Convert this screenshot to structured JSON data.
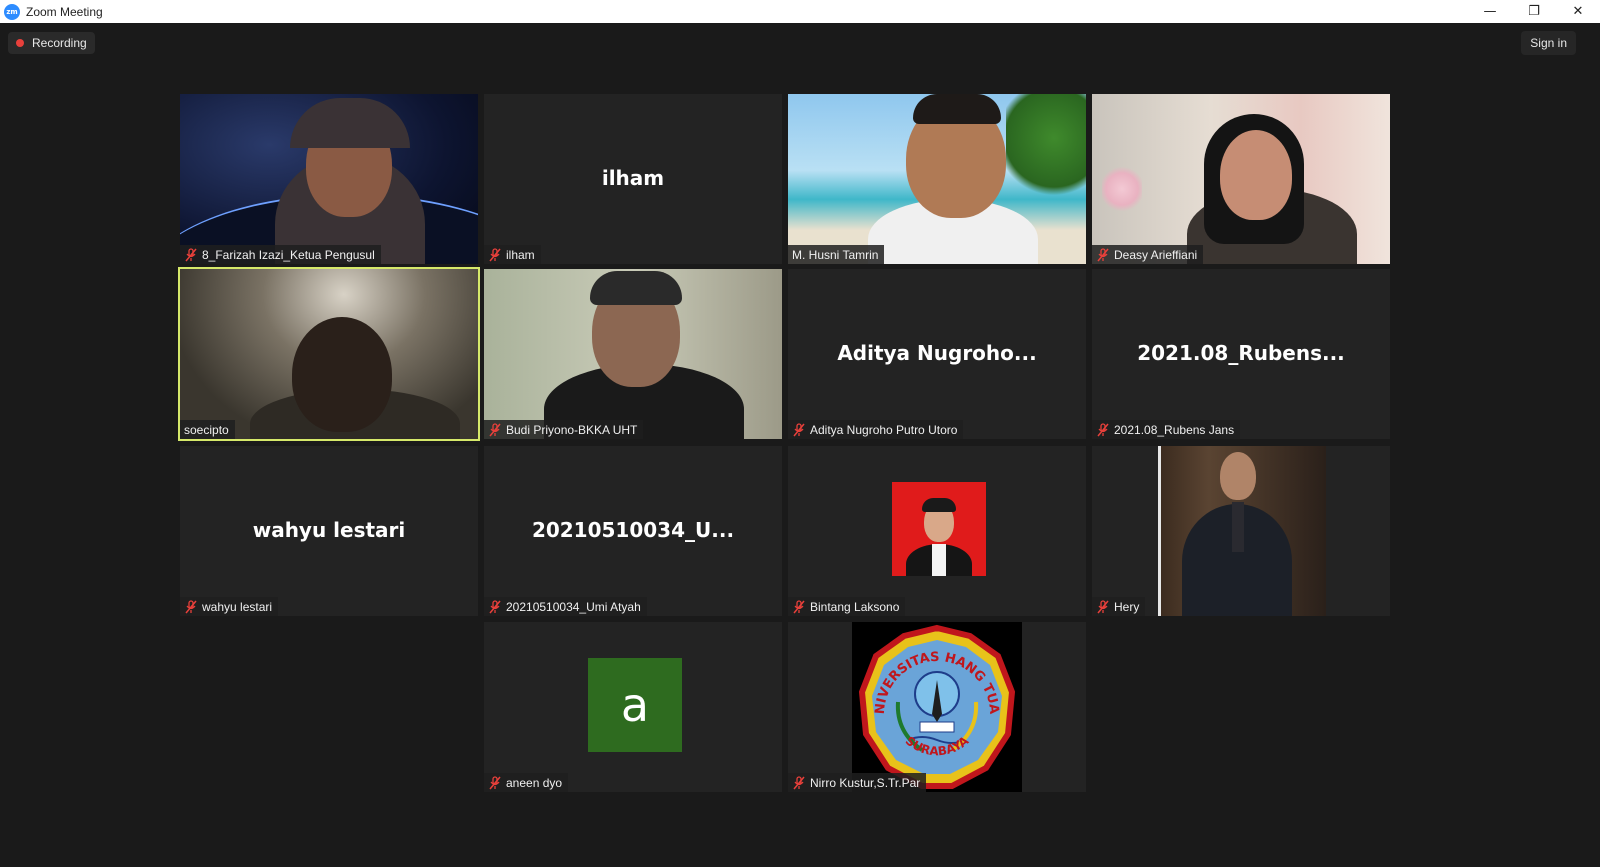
{
  "window": {
    "title": "Zoom Meeting",
    "logo_text": "zm",
    "minimize": "—",
    "restore": "❐",
    "close": "✕"
  },
  "header": {
    "recording_label": "Recording",
    "signin_label": "Sign in",
    "recording_color": "#e8403b"
  },
  "participants": [
    {
      "name": "8_Farizah Izazi_Ketua Pengusul",
      "muted": true,
      "video": "on"
    },
    {
      "name": "ilham",
      "display": "ilham",
      "muted": true,
      "video": "off"
    },
    {
      "name": "M. Husni Tamrin",
      "muted": false,
      "video": "on"
    },
    {
      "name": "Deasy Arieffiani",
      "muted": true,
      "video": "on"
    },
    {
      "name": "soecipto",
      "muted": false,
      "video": "on",
      "active_speaker": true
    },
    {
      "name": "Budi Priyono-BKKA UHT",
      "muted": true,
      "video": "on"
    },
    {
      "name": "Aditya Nugroho Putro Utoro",
      "display": "Aditya  Nugroho...",
      "muted": true,
      "video": "off"
    },
    {
      "name": "2021.08_Rubens Jans",
      "display": "2021.08_Rubens...",
      "muted": true,
      "video": "off"
    },
    {
      "name": "wahyu lestari",
      "display": "wahyu lestari",
      "muted": true,
      "video": "off"
    },
    {
      "name": "20210510034_Umi Atyah",
      "display": "20210510034_U...",
      "muted": true,
      "video": "off"
    },
    {
      "name": "Bintang Laksono",
      "muted": true,
      "video": "profile-photo"
    },
    {
      "name": "Hery",
      "muted": true,
      "video": "on"
    },
    {
      "name": "aneen dyo",
      "avatar_letter": "a",
      "muted": true,
      "video": "avatar"
    },
    {
      "name": "Nirro Kustur,S.Tr.Par",
      "muted": true,
      "video": "logo"
    }
  ],
  "logo_text": {
    "top": "UNIVERSITAS HANG TUAH",
    "bottom": "SURABAYA"
  }
}
